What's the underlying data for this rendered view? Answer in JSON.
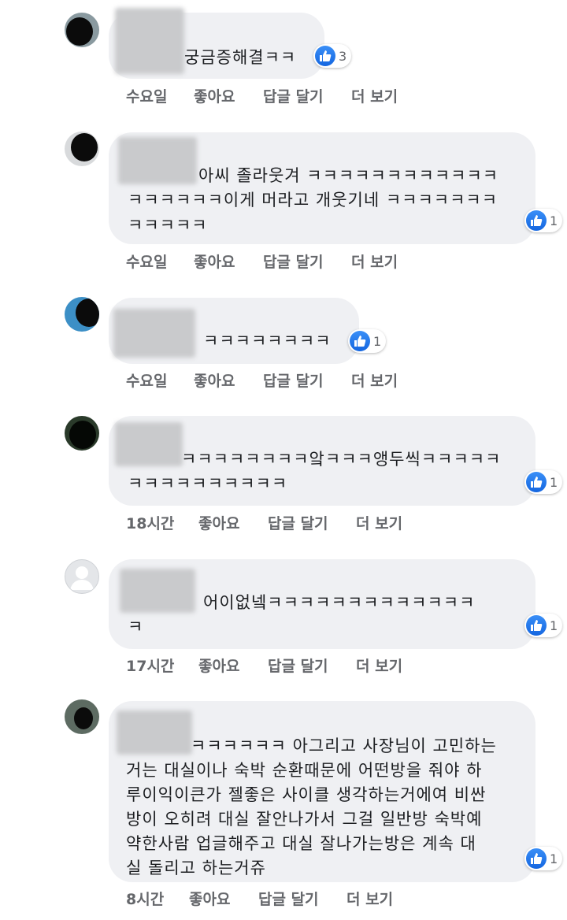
{
  "comments": [
    {
      "lines": [
        "궁금증해결ㅋㅋ"
      ],
      "likes": "3",
      "time": "수요일",
      "like_label": "좋아요",
      "reply_label": "답글 달기",
      "more_label": "더 보기"
    },
    {
      "lines": [
        "아씨 졸라웃겨 ㅋㅋㅋㅋㅋㅋㅋㅋㅋㅋㅋㅋ",
        "ㅋㅋㅋㅋㅋㅋ이게 머라고 개웃기네 ㅋㅋㅋㅋㅋㅋㅋ",
        "ㅋㅋㅋㅋㅋ"
      ],
      "likes": "1",
      "time": "수요일",
      "like_label": "좋아요",
      "reply_label": "답글 달기",
      "more_label": "더 보기"
    },
    {
      "lines": [
        "ㅋㅋㅋㅋㅋㅋㅋㅋ"
      ],
      "likes": "1",
      "time": "수요일",
      "like_label": "좋아요",
      "reply_label": "답글 달기",
      "more_label": "더 보기"
    },
    {
      "lines": [
        "ㅋㅋㅋㅋㅋㅋㅋㅋ앜ㅋㅋㅋ앵두씩ㅋㅋㅋㅋㅋ",
        "ㅋㅋㅋㅋㅋㅋㅋㅋㅋㅋ"
      ],
      "likes": "1",
      "time": "18시간",
      "like_label": "좋아요",
      "reply_label": "답글 달기",
      "more_label": "더 보기"
    },
    {
      "lines": [
        "어이없넼ㅋㅋㅋㅋㅋㅋㅋㅋㅋㅋㅋㅋㅋ",
        "ㅋ"
      ],
      "likes": "1",
      "time": "17시간",
      "like_label": "좋아요",
      "reply_label": "답글 달기",
      "more_label": "더 보기"
    },
    {
      "lines": [
        "ㅋㅋㅋㅋㅋㅋ 아그리고 사장님이 고민하는",
        "거는 대실이나 숙박 순환때문에 어떤방을 줘야 하",
        "루이익이큰가 젤좋은 사이클 생각하는거에여 비싼",
        "방이 오히려 대실 잘안나가서 그걸 일반방 숙박예",
        "약한사람 업글해주고 대실 잘나가는방은 계속 대",
        "실 돌리고 하는거쥬"
      ],
      "likes": "1",
      "time": "8시간",
      "like_label": "좋아요",
      "reply_label": "답글 달기",
      "more_label": "더 보기"
    }
  ],
  "colors": {
    "bubble": "#eff0f3",
    "meta_text": "#65676b",
    "like_blue": "#1877f2"
  },
  "icons": {
    "reaction": "like-thumb-icon",
    "avatar_placeholder": "default-user-icon"
  }
}
